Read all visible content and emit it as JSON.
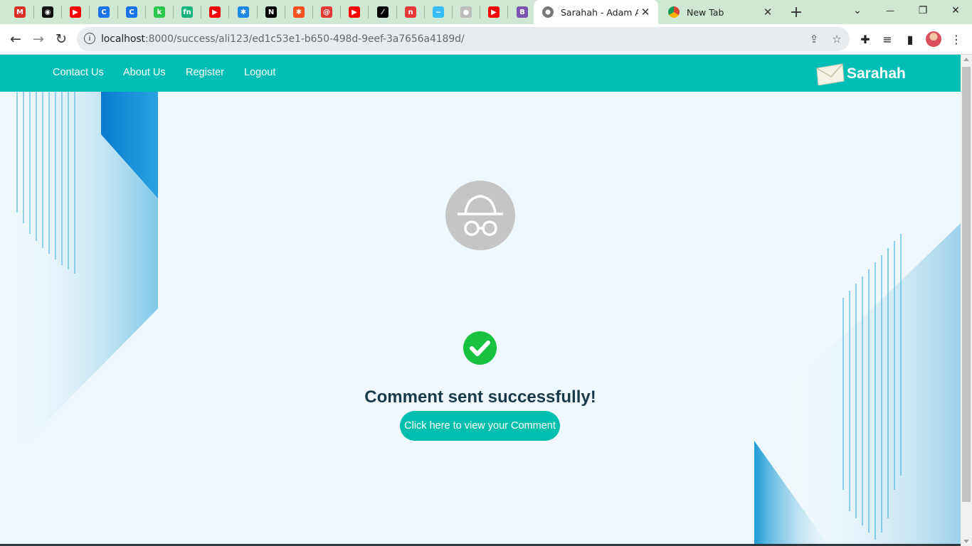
{
  "browser": {
    "pinned_tabs": [
      {
        "icon": "gmail-icon",
        "color": "#d93025",
        "glyph": "M"
      },
      {
        "icon": "github-icon",
        "color": "#111111",
        "glyph": "◉"
      },
      {
        "icon": "youtube-icon",
        "color": "#ff0000",
        "glyph": "▶"
      },
      {
        "icon": "c-icon",
        "color": "#1a73e8",
        "glyph": "C"
      },
      {
        "icon": "c-icon",
        "color": "#1a73e8",
        "glyph": "C"
      },
      {
        "icon": "chart-icon",
        "color": "#2cc84d",
        "glyph": "k"
      },
      {
        "icon": "fn-icon",
        "color": "#16b57f",
        "glyph": "fn"
      },
      {
        "icon": "youtube-icon",
        "color": "#ff0000",
        "glyph": "▶"
      },
      {
        "icon": "puzzle-color-icon",
        "color": "#1e88e5",
        "glyph": "✱"
      },
      {
        "icon": "nextjs-icon",
        "color": "#000000",
        "glyph": "N"
      },
      {
        "icon": "asterisk-icon",
        "color": "#f4511e",
        "glyph": "✱"
      },
      {
        "icon": "spiral-icon",
        "color": "#e53935",
        "glyph": "@"
      },
      {
        "icon": "youtube-icon",
        "color": "#ff0000",
        "glyph": "▶"
      },
      {
        "icon": "slash-icon",
        "color": "#000000",
        "glyph": "⁄"
      },
      {
        "icon": "n-square-icon",
        "color": "#e53935",
        "glyph": "n"
      },
      {
        "icon": "tailwind-icon",
        "color": "#38bdf8",
        "glyph": "~"
      },
      {
        "icon": "globe-gray-icon",
        "color": "#bdbdbd",
        "glyph": "●"
      },
      {
        "icon": "youtube-icon",
        "color": "#ff0000",
        "glyph": "▶"
      },
      {
        "icon": "bootstrap-icon",
        "color": "#7952b3",
        "glyph": "B"
      }
    ],
    "tabs": [
      {
        "title": "Sarahah - Adam Anil",
        "active": true
      },
      {
        "title": "New Tab",
        "active": false
      }
    ],
    "new_tab_glyph": "+",
    "window_controls": {
      "menu": "⌄",
      "minimize": "—",
      "restore": "❐",
      "close": "✕"
    },
    "url_host": "localhost",
    "url_rest": ":8000/success/ali123/ed1c53e1-b650-498d-9eef-3a7656a4189d/",
    "nav": {
      "back": "←",
      "forward": "→",
      "reload": "↻"
    }
  },
  "site": {
    "accent": "#00bdb5",
    "nav_links": [
      "Contact Us",
      "About Us",
      "Register",
      "Logout"
    ],
    "brand": "Sarahah",
    "headline": "Comment sent successfully!",
    "cta_label": "Click here to view your Comment",
    "success_color": "#16c23f"
  }
}
